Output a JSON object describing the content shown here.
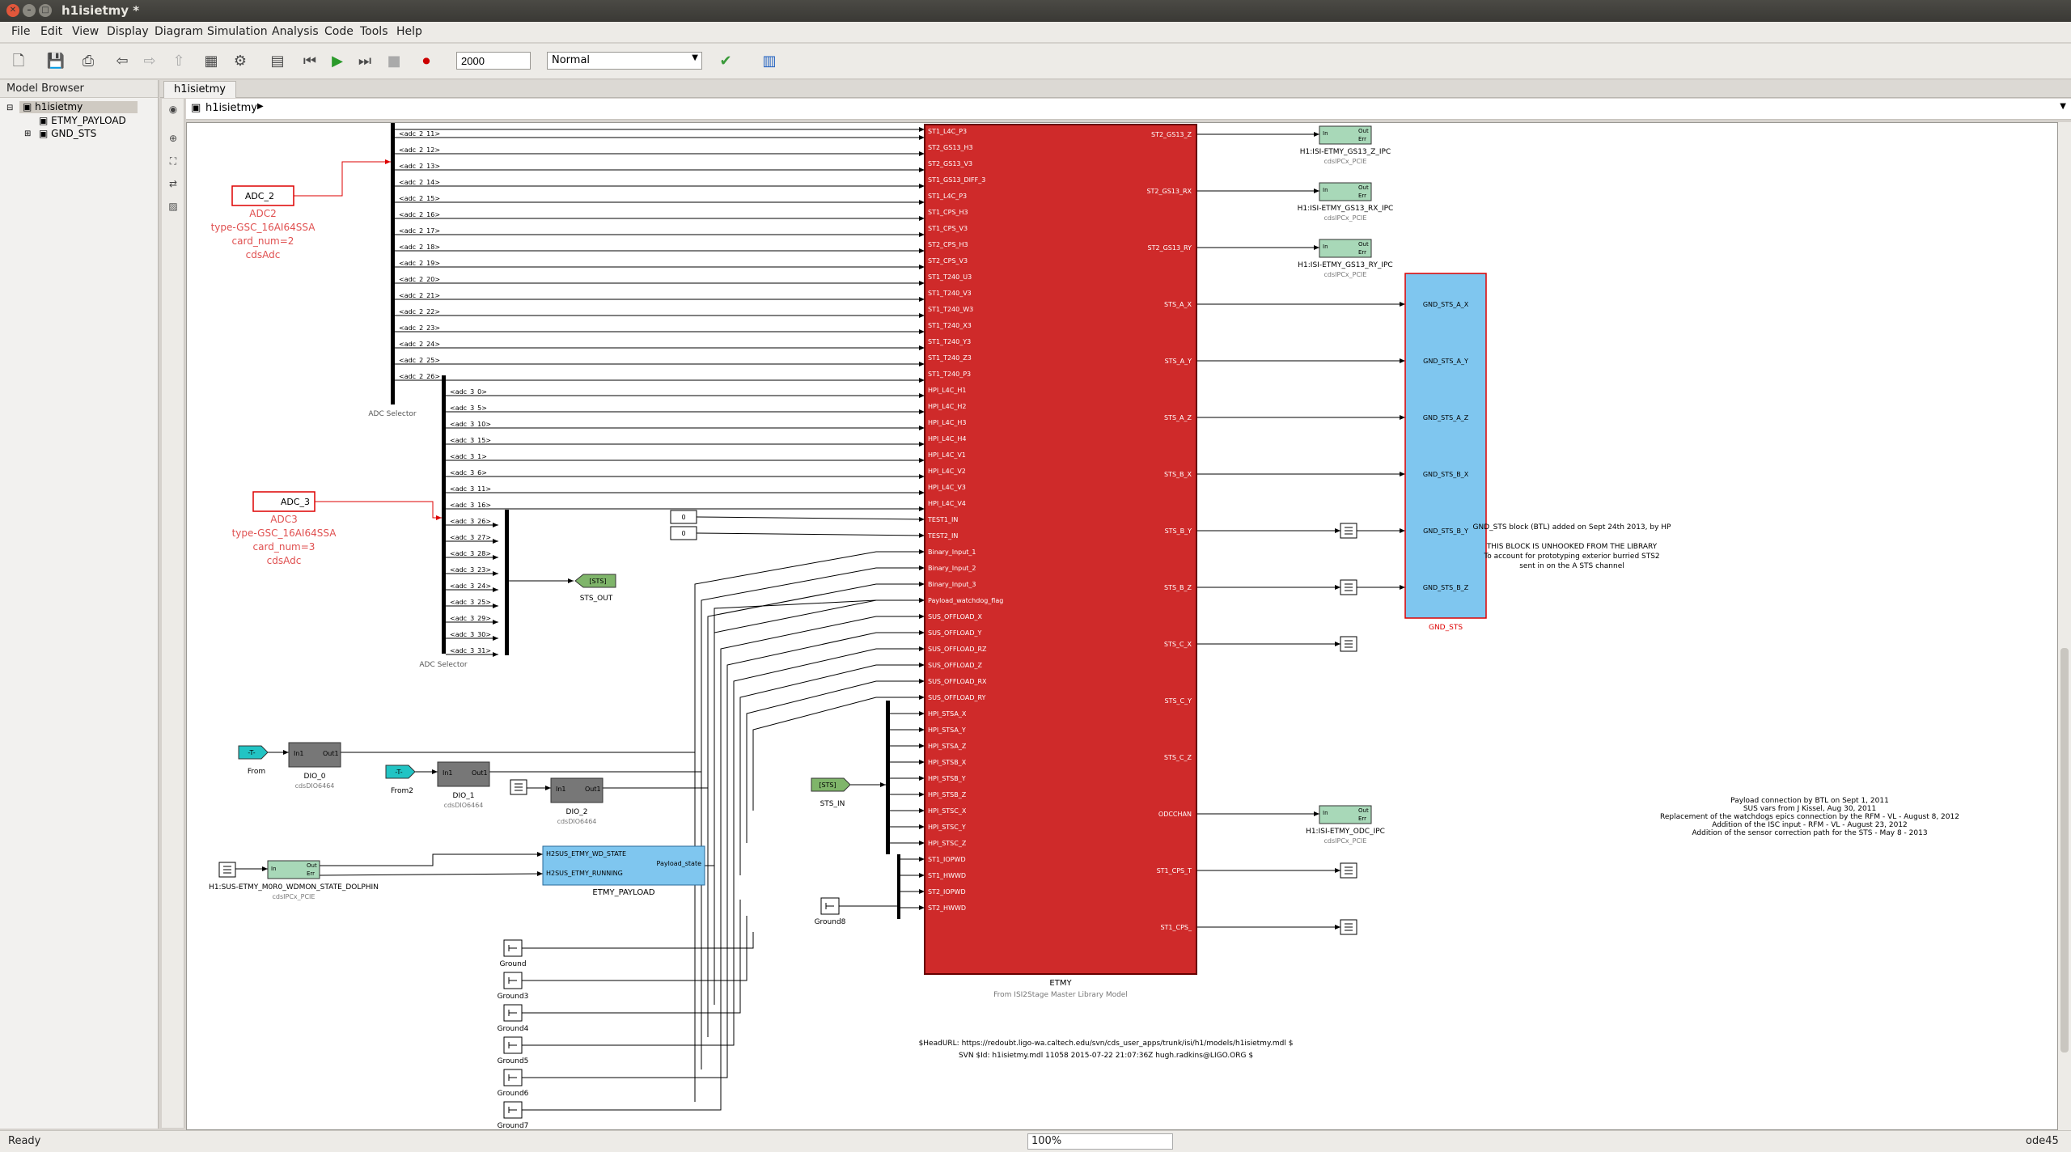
{
  "window": {
    "title": "h1isietmy *"
  },
  "menu": [
    "File",
    "Edit",
    "View",
    "Display",
    "Diagram",
    "Simulation",
    "Analysis",
    "Code",
    "Tools",
    "Help"
  ],
  "toolbar": {
    "stop_time": "2000",
    "sim_mode": "Normal"
  },
  "model_browser": {
    "title": "Model Browser",
    "root": "h1isietmy",
    "children": [
      "ETMY_PAYLOAD",
      "GND_STS"
    ]
  },
  "tab": {
    "label": "h1isietmy"
  },
  "address": {
    "path": "h1isietmy"
  },
  "status": {
    "left": "Ready",
    "zoom": "100%",
    "solver": "ode45"
  },
  "diagram": {
    "adc2": {
      "name": "ADC_2",
      "title": "ADC2",
      "type": "type-GSC_16AI64SSA",
      "card": "card_num=2",
      "lib": "cdsAdc"
    },
    "adc3": {
      "name": "ADC_3",
      "title": "ADC3",
      "type": "type-GSC_16AI64SSA",
      "card": "card_num=3",
      "lib": "cdsAdc"
    },
    "adc_selector_label": "ADC Selector",
    "adc2_channels": [
      "<adc_2_11>",
      "<adc_2_12>",
      "<adc_2_13>",
      "<adc_2_14>",
      "<adc_2_15>",
      "<adc_2_16>",
      "<adc_2_17>",
      "<adc_2_18>",
      "<adc_2_19>",
      "<adc_2_20>",
      "<adc_2_21>",
      "<adc_2_22>",
      "<adc_2_23>",
      "<adc_2_24>",
      "<adc_2_25>",
      "<adc_2_26>"
    ],
    "adc3_channels": [
      "<adc_3_0>",
      "<adc_3_5>",
      "<adc_3_10>",
      "<adc_3_15>",
      "<adc_3_1>",
      "<adc_3_6>",
      "<adc_3_11>",
      "<adc_3_16>",
      "<adc_3_26>",
      "<adc_3_27>",
      "<adc_3_28>",
      "<adc_3_23>",
      "<adc_3_24>",
      "<adc_3_25>",
      "<adc_3_29>",
      "<adc_3_30>",
      "<adc_3_31>"
    ],
    "etmy_inputs": [
      "ST1_L4C_P3",
      "ST2_GS13_H3",
      "ST2_GS13_V3",
      "ST1_GS13_DIFF_3",
      "ST1_L4C_P3",
      "ST1_CPS_H3",
      "ST1_CPS_V3",
      "ST2_CPS_H3",
      "ST2_CPS_V3",
      "ST1_T240_U3",
      "ST1_T240_V3",
      "ST1_T240_W3",
      "ST1_T240_X3",
      "ST1_T240_Y3",
      "ST1_T240_Z3",
      "ST1_T240_P3",
      "HPI_L4C_H1",
      "HPI_L4C_H2",
      "HPI_L4C_H3",
      "HPI_L4C_H4",
      "HPI_L4C_V1",
      "HPI_L4C_V2",
      "HPI_L4C_V3",
      "HPI_L4C_V4",
      "TEST1_IN",
      "TEST2_IN",
      "Binary_Input_1",
      "Binary_Input_2",
      "Binary_Input_3",
      "Payload_watchdog_flag",
      "SUS_OFFLOAD_X",
      "SUS_OFFLOAD_Y",
      "SUS_OFFLOAD_RZ",
      "SUS_OFFLOAD_Z",
      "SUS_OFFLOAD_RX",
      "SUS_OFFLOAD_RY",
      "HPI_STSA_X",
      "HPI_STSA_Y",
      "HPI_STSA_Z",
      "HPI_STSB_X",
      "HPI_STSB_Y",
      "HPI_STSB_Z",
      "HPI_STSC_X",
      "HPI_STSC_Y",
      "HPI_STSC_Z",
      "ST1_IOPWD",
      "ST1_HWWD",
      "ST2_IOPWD",
      "ST2_HWWD"
    ],
    "etmy_outputs": [
      "ST2_GS13_Z",
      "ST2_GS13_RX",
      "ST2_GS13_RY",
      "STS_A_X",
      "STS_A_Y",
      "STS_A_Z",
      "STS_B_X",
      "STS_B_Y",
      "STS_B_Z",
      "STS_C_X",
      "STS_C_Y",
      "STS_C_Z",
      "ODCCHAN",
      "ST1_CPS_T",
      "ST1_CPS_"
    ],
    "etmy_name": "ETMY",
    "etmy_sub": "From ISI2Stage Master Library Model",
    "ipc_gs13_z": "H1:ISI-ETMY_GS13_Z_IPC",
    "ipc_gs13_rx": "H1:ISI-ETMY_GS13_RX_IPC",
    "ipc_gs13_ry": "H1:ISI-ETMY_GS13_RY_IPC",
    "ipc_odc": "H1:ISI-ETMY_ODC_IPC",
    "ipc_lib": "cdsIPCx_PCIE",
    "ipc_in": "In",
    "ipc_out": "Out",
    "ipc_err": "Err",
    "gnd_sts_ports": [
      "GND_STS_A_X",
      "GND_STS_A_Y",
      "GND_STS_A_Z",
      "GND_STS_B_X",
      "GND_STS_B_Y",
      "GND_STS_B_Z"
    ],
    "gnd_sts_name": "GND_STS",
    "gnd_note": [
      "GND_STS  block (BTL) added on Sept 24th 2013, by HP",
      "THIS BLOCK IS UNHOOKED FROM THE LIBRARY",
      "To account for prototyping exterior burried STS2",
      "sent in on the A STS channel"
    ],
    "payload_note": [
      "Payload connection by BTL on Sept 1, 2011",
      "SUS vars from J Kissel, Aug 30, 2011",
      "Replacement of the watchdogs epics connection by the RFM - VL - August 8, 2012",
      "Addition of the ISC input - RFM - VL - August 23, 2012",
      "Addition of the sensor correction path for the STS - May 8 - 2013"
    ],
    "svn": [
      "$HeadURL: https://redoubt.ligo-wa.caltech.edu/svn/cds_user_apps/trunk/isi/h1/models/h1isietmy.mdl $",
      "SVN $Id: h1isietmy.mdl 11058 2015-07-22 21:07:36Z hugh.radkins@LIGO.ORG $"
    ],
    "test_consts": [
      "0",
      "0"
    ],
    "sts_out": "STS_OUT",
    "sts_in": "STS_IN",
    "sts_tag": "[STS]",
    "from_tag": "-T-",
    "from1": "From",
    "from2": "From2",
    "dio0": "DIO_0",
    "dio1": "DIO_1",
    "dio2": "DIO_2",
    "dio_lib": "cdsDIO6464",
    "port_in1": "In1",
    "port_out1": "Out1",
    "sus_ipc": "H1:SUS-ETMY_M0R0_WDMON_STATE_DOLPHIN",
    "payload_in1": "H2SUS_ETMY_WD_STATE",
    "payload_in2": "H2SUS_ETMY_RUNNING",
    "payload_out": "Payload_state",
    "payload_name": "ETMY_PAYLOAD",
    "grounds": [
      "Ground",
      "Ground3",
      "Ground4",
      "Ground5",
      "Ground6",
      "Ground7"
    ],
    "ground8": "Ground8"
  },
  "colors": {
    "etmy_fill": "#cf2a2a",
    "gnd_sts_fill": "#7fc6ef",
    "adc_label": "#e05050",
    "ipc_fill": "#a8d8b8",
    "from_fill": "#22c4c4",
    "sts_tag_fill": "#7fb56a"
  }
}
